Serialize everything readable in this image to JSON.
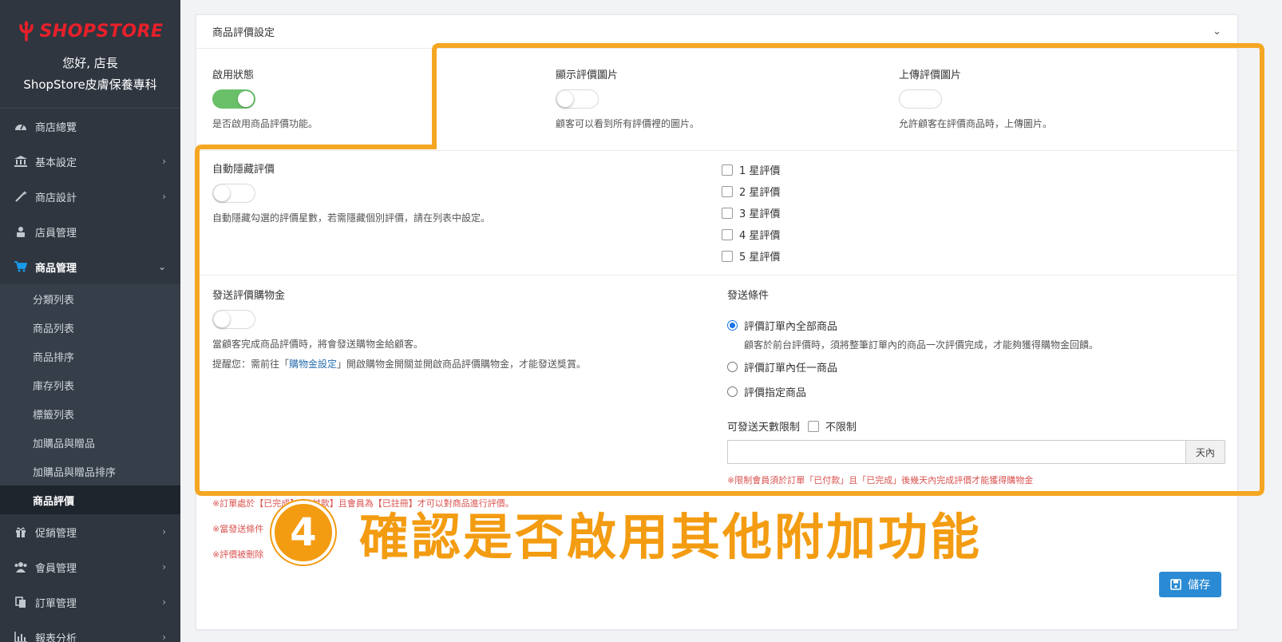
{
  "sidebar": {
    "logo_text": "SHOPSTORE",
    "greeting": "您好, 店長",
    "shop_name": "ShopStore皮膚保養專科",
    "items": [
      {
        "label": "商店總覽",
        "icon": "dashboard-icon"
      },
      {
        "label": "基本設定",
        "icon": "bank-icon"
      },
      {
        "label": "商店設計",
        "icon": "magic-wand-icon"
      },
      {
        "label": "店員管理",
        "icon": "user-lock-icon"
      },
      {
        "label": "商品管理",
        "icon": "cart-icon"
      },
      {
        "label": "促銷管理",
        "icon": "gift-icon"
      },
      {
        "label": "會員管理",
        "icon": "users-icon"
      },
      {
        "label": "訂單管理",
        "icon": "copy-icon"
      },
      {
        "label": "報表分析",
        "icon": "bar-chart-icon"
      }
    ],
    "sub_items": [
      "分類列表",
      "商品列表",
      "商品排序",
      "庫存列表",
      "標籤列表",
      "加購品與贈品",
      "加購品與贈品排序",
      "商品評價"
    ]
  },
  "card": {
    "title": "商品評價設定",
    "enable": {
      "label": "啟用狀態",
      "help": "是否啟用商品評價功能。",
      "on": true
    },
    "show_images": {
      "label": "顯示評價圖片",
      "help": "顧客可以看到所有評價裡的圖片。",
      "on": false
    },
    "upload_images": {
      "label": "上傳評價圖片",
      "help": "允許顧客在評價商品時，上傳圖片。",
      "on": false
    },
    "auto_hide": {
      "label": "自動隱藏評價",
      "help": "自動隱藏勾選的評價星數，若需隱藏個別評價，請在列表中設定。",
      "on": false
    },
    "stars": [
      "1 星評價",
      "2 星評價",
      "3 星評價",
      "4 星評價",
      "5 星評價"
    ],
    "reward": {
      "label": "發送評價購物金",
      "help1": "當顧客完成商品評價時，將會發送購物金給顧客。",
      "help2_prefix": "提醒您：需前往「",
      "help2_link": "購物金設定",
      "help2_suffix": "」開啟購物金開關並開啟商品評價購物金，才能發送獎賞。"
    },
    "conditions": {
      "label": "發送條件",
      "options": [
        "評價訂單內全部商品",
        "評價訂單內任一商品",
        "評價指定商品"
      ],
      "option1_help": "顧客於前台評價時，須將整筆訂單內的商品一次評價完成，才能夠獲得購物金回饋。",
      "days_label": "可發送天數限制",
      "unlimited_label": "不限制",
      "days_suffix": "天內",
      "warning": "※限制會員須於訂單「已付款」且「已完成」後幾天內完成評價才能獲得購物金"
    },
    "notes": [
      "※訂單處於【已完成】【已付款】且會員為【已註冊】才可以對商品進行評價。",
      "※當發送條件",
      "※評價被刪除"
    ],
    "save_label": "儲存"
  },
  "overlay": {
    "step_number": "4",
    "text": "確認是否啟用其他附加功能",
    "color": "#f39c12"
  }
}
